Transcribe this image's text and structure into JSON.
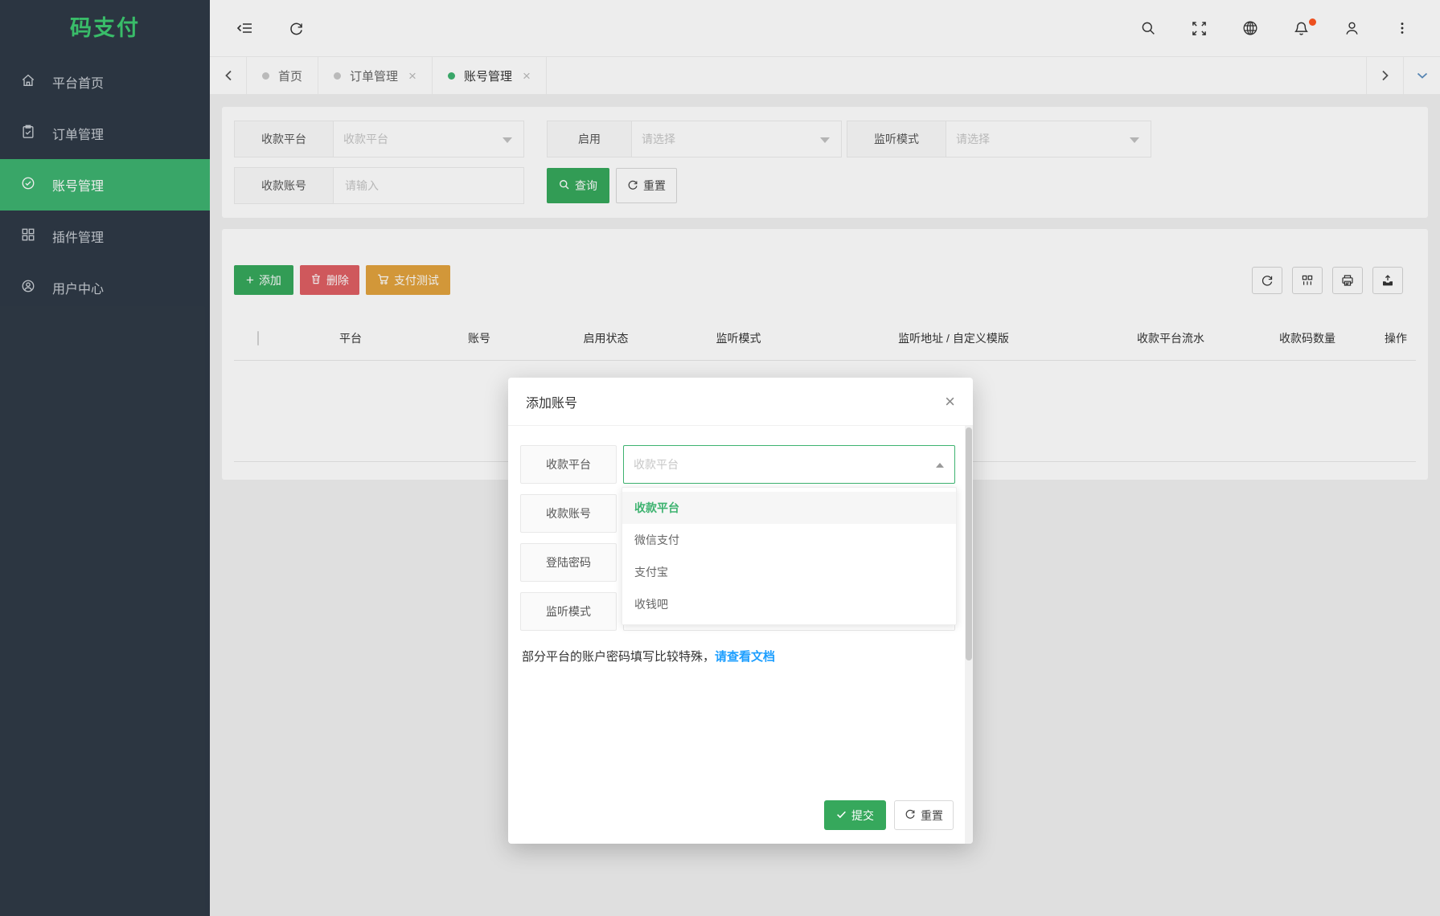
{
  "app": {
    "title": "码支付"
  },
  "colors": {
    "green": "#3eb370",
    "button_green": "#36a85c",
    "red": "#df5f63",
    "orange": "#e2a33e",
    "link_blue": "#1E9FFF",
    "notify_dot": "#ff5722",
    "sidebar_bg": "#2f3a46"
  },
  "glyphs": {
    "close": "×",
    "plus": "+"
  },
  "sidebar": {
    "items": [
      {
        "label": "平台首页",
        "icon": "home-icon",
        "active": false
      },
      {
        "label": "订单管理",
        "icon": "order-icon",
        "active": false
      },
      {
        "label": "账号管理",
        "icon": "account-icon",
        "active": true
      },
      {
        "label": "插件管理",
        "icon": "plugin-icon",
        "active": false
      },
      {
        "label": "用户中心",
        "icon": "user-center-icon",
        "active": false
      }
    ]
  },
  "tabs": {
    "items": [
      {
        "label": "首页",
        "closable": false,
        "active": false
      },
      {
        "label": "订单管理",
        "closable": true,
        "active": false
      },
      {
        "label": "账号管理",
        "closable": true,
        "active": true
      }
    ]
  },
  "filter": {
    "fields": [
      {
        "label": "收款平台",
        "placeholder": "收款平台"
      },
      {
        "label": "启用",
        "placeholder": "请选择"
      },
      {
        "label": "监听模式",
        "placeholder": "请选择"
      },
      {
        "label": "收款账号",
        "placeholder": "请输入"
      }
    ],
    "search_button": "查询",
    "reset_button": "重置"
  },
  "toolbar": {
    "add_button": "添加",
    "delete_button": "删除",
    "pay_test_button": "支付测试"
  },
  "table": {
    "columns": [
      "平台",
      "账号",
      "启用状态",
      "监听模式",
      "监听地址 / 自定义模版",
      "收款平台流水",
      "收款码数量",
      "操作"
    ]
  },
  "modal": {
    "title": "添加账号",
    "fields": [
      {
        "label": "收款平台",
        "placeholder": "收款平台"
      },
      {
        "label": "收款账号"
      },
      {
        "label": "登陆密码"
      },
      {
        "label": "监听模式"
      }
    ],
    "dropdown_options": [
      {
        "label": "收款平台",
        "selected": true
      },
      {
        "label": "微信支付",
        "selected": false
      },
      {
        "label": "支付宝",
        "selected": false
      },
      {
        "label": "收钱吧",
        "selected": false
      }
    ],
    "hint_text": "部分平台的账户密码填写比较特殊，",
    "hint_link": "请查看文档",
    "submit_button": "提交",
    "reset_button": "重置"
  }
}
